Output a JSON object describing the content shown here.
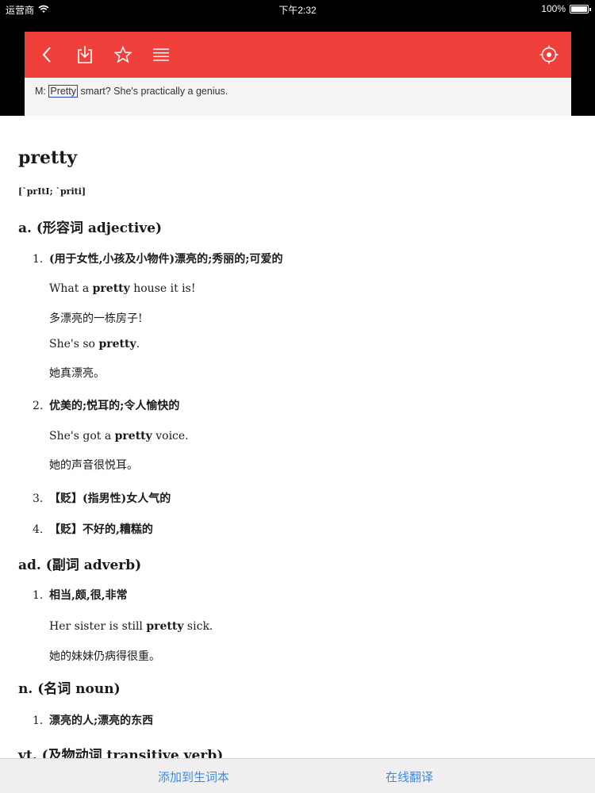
{
  "status_bar": {
    "carrier": "运营商",
    "time": "下午2:32",
    "battery": "100%"
  },
  "source": {
    "prefix": "M: ",
    "highlight": "Pretty",
    "rest": " smart? She's practically a genius.",
    "toolbar_color": "#f0403c"
  },
  "entry": {
    "word": "pretty",
    "phonetic": "[`prItI; `priti]",
    "sections": [
      {
        "pos": "a. (形容词 adjective)",
        "senses": [
          {
            "num": "1.",
            "def": "(用于女性,小孩及小物件)漂亮的;秀丽的;可爱的",
            "examples": [
              {
                "pre": "What a ",
                "hw": "pretty",
                "post": " house it is!"
              },
              {
                "pre": "多漂亮的一栋房子!",
                "hw": "",
                "post": ""
              },
              {
                "pre": "She's so ",
                "hw": "pretty",
                "post": "."
              },
              {
                "pre": "她真漂亮。",
                "hw": "",
                "post": ""
              }
            ]
          },
          {
            "num": "2.",
            "def": "优美的;悦耳的;令人愉快的",
            "examples": [
              {
                "pre": "She's got a ",
                "hw": "pretty",
                "post": " voice."
              },
              {
                "pre": "她的声音很悦耳。",
                "hw": "",
                "post": ""
              }
            ]
          },
          {
            "num": "3.",
            "def": "【贬】(指男性)女人气的",
            "examples": []
          },
          {
            "num": "4.",
            "def": "【贬】不好的,糟糕的",
            "examples": []
          }
        ]
      },
      {
        "pos": "ad. (副词 adverb)",
        "senses": [
          {
            "num": "1.",
            "def": "相当,颇,很,非常",
            "examples": [
              {
                "pre": "Her sister is still ",
                "hw": "pretty",
                "post": " sick."
              },
              {
                "pre": "她的妹妹仍病得很重。",
                "hw": "",
                "post": ""
              }
            ]
          }
        ]
      },
      {
        "pos": "n. (名词 noun)",
        "senses": [
          {
            "num": "1.",
            "def": "漂亮的人;漂亮的东西",
            "examples": []
          }
        ]
      },
      {
        "pos": "vt. (及物动词 transitive verb)",
        "senses": []
      }
    ]
  },
  "bottom_bar": {
    "add_label": "添加到生词本",
    "translate_label": "在线翻译"
  },
  "colors": {
    "accent": "#3c8ce6",
    "toolbar": "#f0403c"
  }
}
